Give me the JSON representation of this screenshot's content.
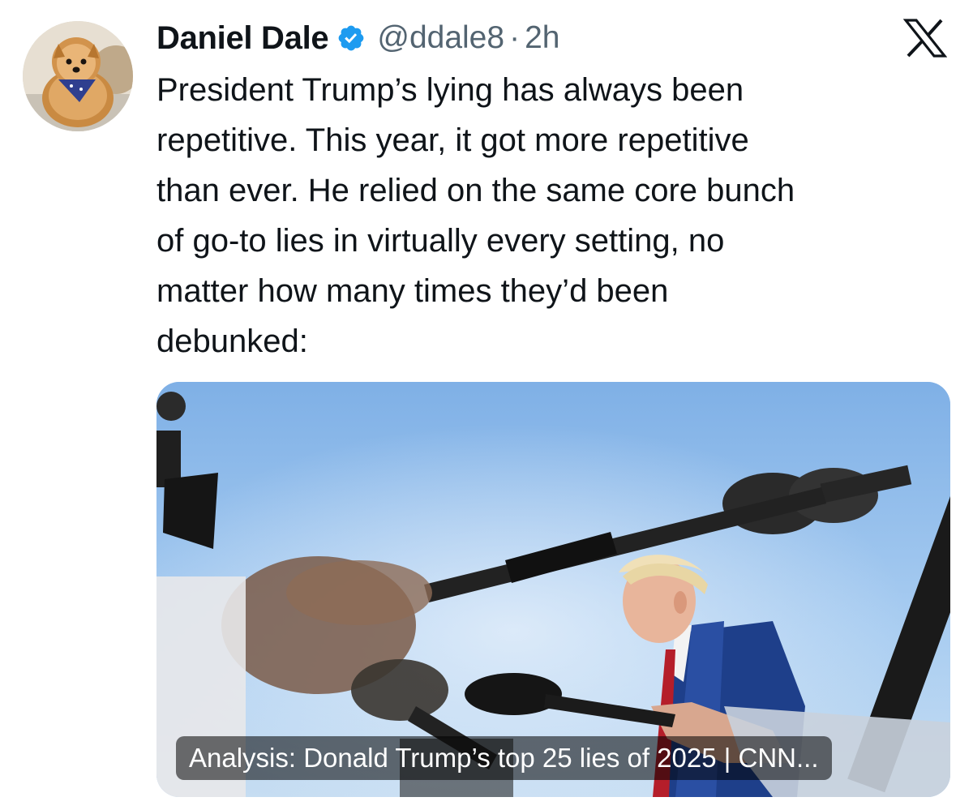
{
  "author": {
    "display_name": "Daniel Dale",
    "handle": "@ddale8",
    "separator": "·",
    "timestamp": "2h",
    "verified_icon": "verified-badge-icon",
    "avatar_icon": "avatar-pomeranian-photo"
  },
  "platform": {
    "logo": "x-logo-icon"
  },
  "tweet": {
    "text": "President Trump’s lying has always been\nrepetitive. This year, it got more repetitive\nthan ever. He relied on the same core bunch\nof go-to lies in virtually every setting, no\nmatter how many times they’d been\ndebunked:"
  },
  "link_card": {
    "caption": "Analysis: Donald Trump’s top 25 lies of 2025 | CNN..."
  },
  "colors": {
    "text_primary": "#0f1419",
    "text_secondary": "#536471",
    "verified_blue": "#1d9bf0",
    "sky_blue": "#9ec4ee"
  }
}
